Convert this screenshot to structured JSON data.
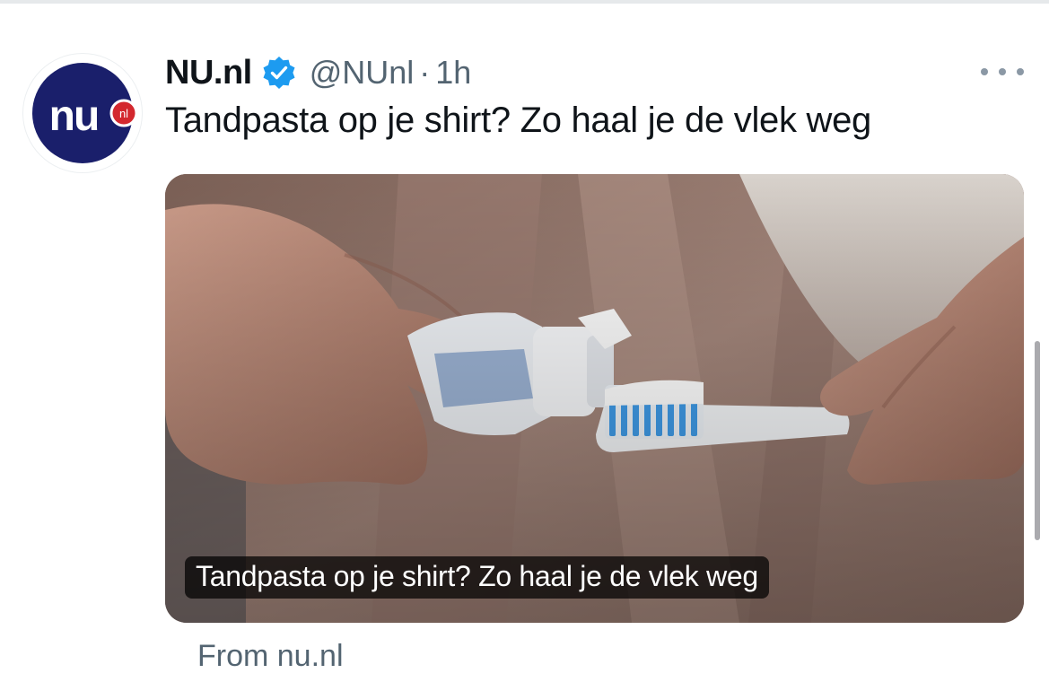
{
  "tweet": {
    "display_name": "NU.nl",
    "handle": "@NUnl",
    "separator": "·",
    "timestamp": "1h",
    "text": "Tandpasta op je shirt? Zo haal je de vlek weg",
    "verified": true
  },
  "avatar": {
    "logo_text": "nu",
    "badge_text": "nl"
  },
  "card": {
    "caption": "Tandpasta op je shirt? Zo haal je de vlek weg",
    "image_subject": "hands squeezing toothpaste onto a toothbrush"
  },
  "source": {
    "label": "From nu.nl"
  },
  "icons": {
    "verified": "verified-badge-icon",
    "more": "more-dots-icon"
  },
  "colors": {
    "text_primary": "#0f1419",
    "text_secondary": "#536471",
    "verified_blue": "#1d9bf0",
    "nu_blue": "#1a1f6b",
    "nu_red": "#d3282e"
  }
}
